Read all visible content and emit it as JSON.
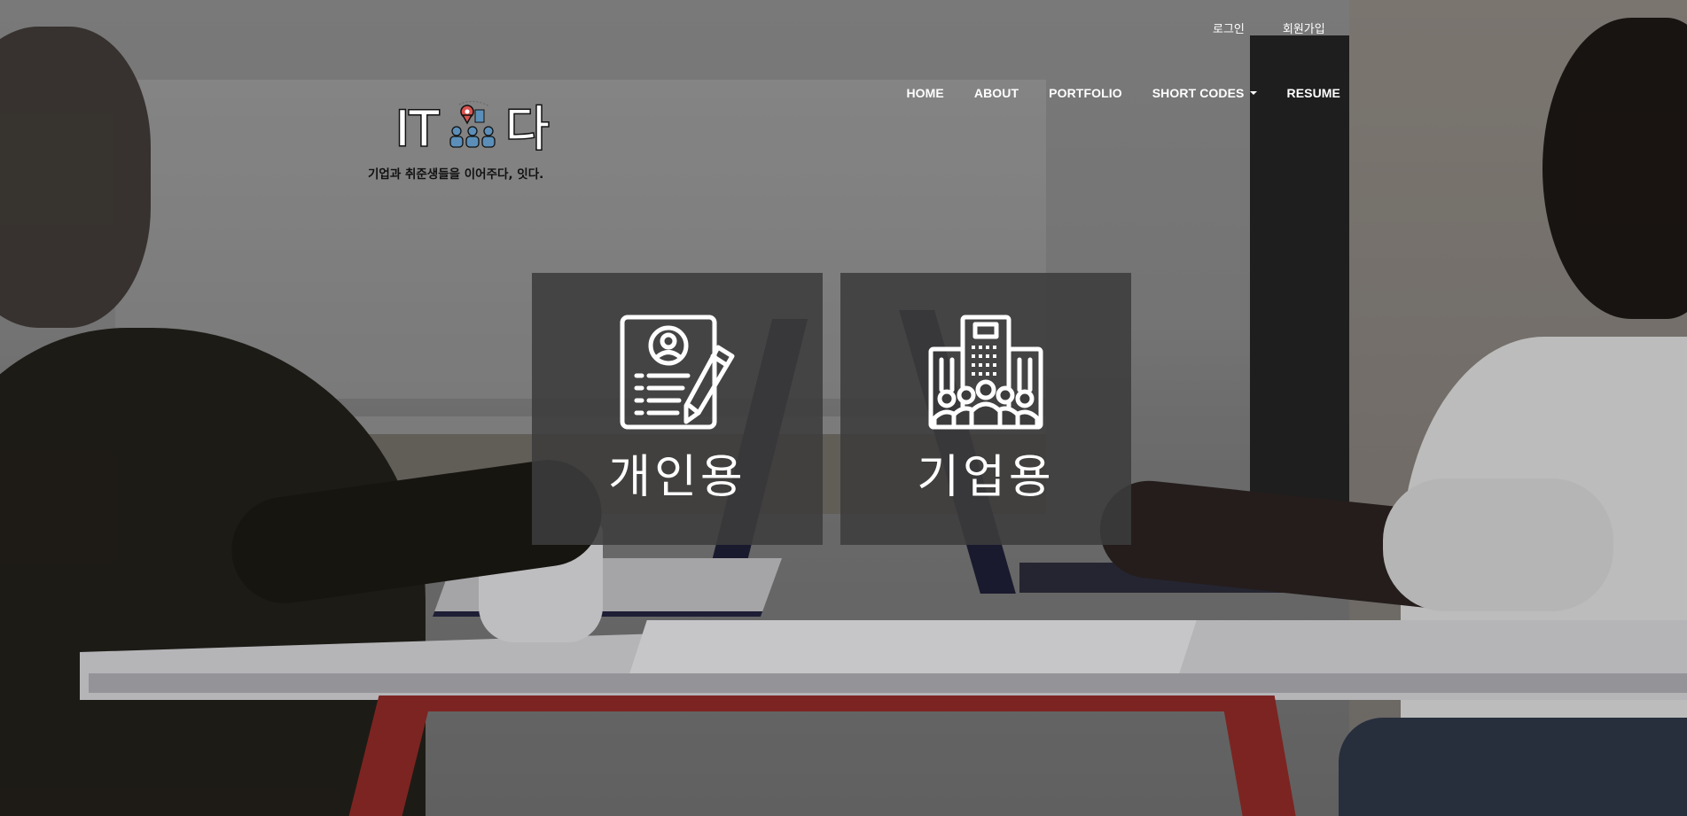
{
  "top_links": {
    "login": "로그인",
    "signup": "회원가입"
  },
  "nav": {
    "items": [
      {
        "label": "HOME"
      },
      {
        "label": "ABOUT"
      },
      {
        "label": "PORTFOLIO"
      },
      {
        "label": "SHORT CODES",
        "has_dropdown": true
      },
      {
        "label": "RESUME"
      }
    ]
  },
  "logo": {
    "text_left": "IT",
    "text_right": "다",
    "tagline": "기업과 취준생들을 이어주다, 잇다."
  },
  "cards": [
    {
      "label": "개인용",
      "icon": "resume-document-pencil-icon"
    },
    {
      "label": "기업용",
      "icon": "office-building-people-icon"
    }
  ],
  "colors": {
    "card_background": "#3c3c3c",
    "text": "#ffffff",
    "logo_pin": "#d9534f",
    "logo_people": "#5b8fb9"
  }
}
